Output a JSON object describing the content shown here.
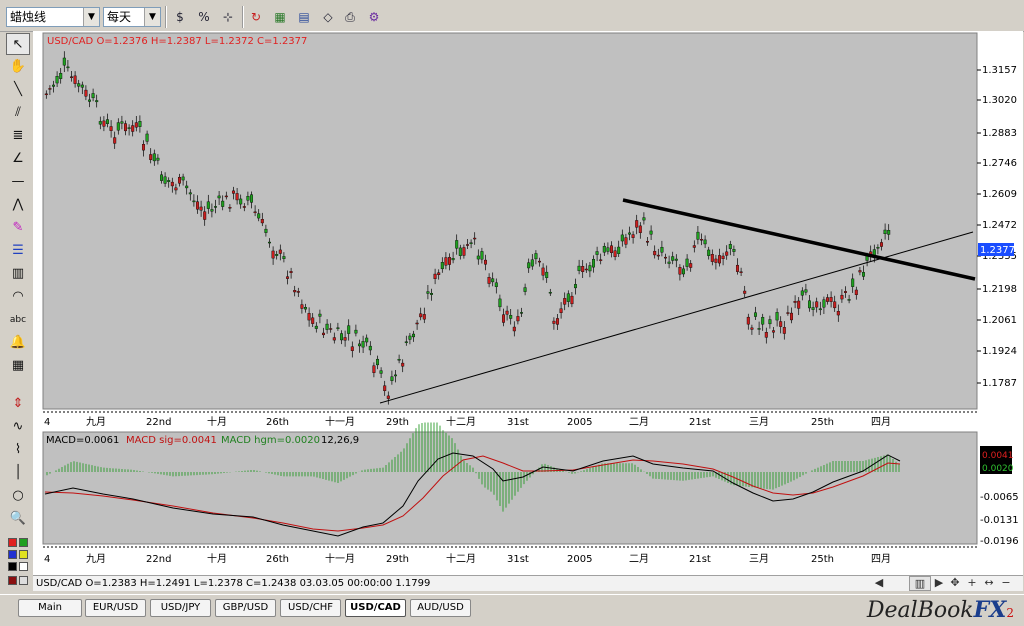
{
  "toolbar": {
    "chart_type": "蜡烛线",
    "period": "每天",
    "icons": [
      "dollar-icon",
      "percent-icon",
      "crosshair-icon",
      "refresh-icon",
      "chart-window-icon",
      "template-icon",
      "open-icon",
      "print-icon",
      "settings-icon"
    ]
  },
  "palette": {
    "text_tool_label": "abc"
  },
  "main_chart": {
    "header": "USD/CAD O=1.2376 H=1.2387 L=1.2372 C=1.2377",
    "price_axis": [
      "1.3157",
      "1.3020",
      "1.2883",
      "1.2746",
      "1.2609",
      "1.2472",
      "1.2335",
      "1.2198",
      "1.2061",
      "1.1924",
      "1.1787"
    ],
    "current_price": "1.2377",
    "date_labels": [
      "4",
      "九月",
      "22nd",
      "十月",
      "26th",
      "十一月",
      "29th",
      "十二月",
      "31st",
      "2005",
      "二月",
      "21st",
      "三月",
      "25th",
      "四月"
    ]
  },
  "macd_chart": {
    "label_main": "MACD=0.0061",
    "label_sig": "MACD sig=0.0041",
    "label_hgm": "MACD hgm=0.0020",
    "params": "12,26,9",
    "axis": [
      "-0.0065",
      "-0.0131",
      "-0.0196"
    ],
    "value_badge_1": "0.0041",
    "value_badge_2": "0.0020"
  },
  "status": {
    "text": "USD/CAD O=1.2383 H=1.2491 L=1.2378 C=1.2438   03.03.05 00:00:00 1.1799"
  },
  "tabs": [
    "Main",
    "EUR/USD",
    "USD/JPY",
    "GBP/USD",
    "USD/CHF",
    "USD/CAD",
    "AUD/USD"
  ],
  "active_tab": "USD/CAD",
  "brand": {
    "deal": "DealBook",
    "fx": "FX",
    "two": "2"
  },
  "colors": {
    "bull": "#1f9f1f",
    "bear": "#c81e1e",
    "panel_bg": "#c0c0c0",
    "header_text": "#e02020",
    "macd_signal": "#c01010",
    "macd_hist": "#2a9a2a"
  }
}
